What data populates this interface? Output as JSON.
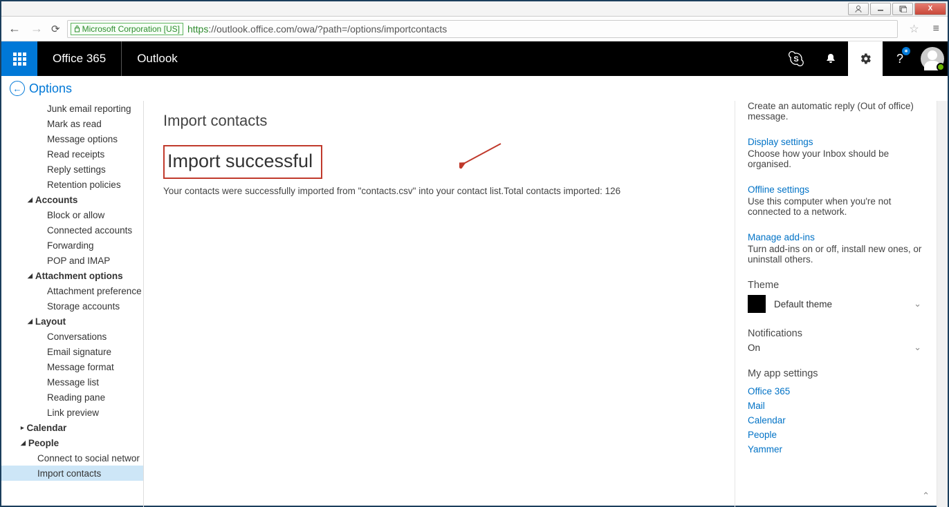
{
  "window": {
    "close_x": "X"
  },
  "browser": {
    "security_badge": "Microsoft Corporation [US]",
    "protocol": "https",
    "url_rest": "://outlook.office.com/owa/?path=/options/importcontacts"
  },
  "suite": {
    "brand1": "Office 365",
    "brand2": "Outlook"
  },
  "optionsbar": {
    "label": "Options"
  },
  "sidebar": {
    "items": [
      "Junk email reporting",
      "Mark as read",
      "Message options",
      "Read receipts",
      "Reply settings",
      "Retention policies"
    ],
    "g_accounts": "Accounts",
    "accounts": [
      "Block or allow",
      "Connected accounts",
      "Forwarding",
      "POP and IMAP"
    ],
    "g_attach": "Attachment options",
    "attach": [
      "Attachment preference",
      "Storage accounts"
    ],
    "g_layout": "Layout",
    "layout": [
      "Conversations",
      "Email signature",
      "Message format",
      "Message list",
      "Reading pane",
      "Link preview"
    ],
    "g_calendar": "Calendar",
    "g_people": "People",
    "people": [
      "Connect to social networ",
      "Import contacts"
    ]
  },
  "main": {
    "heading": "Import contacts",
    "success_heading": "Import successful",
    "success_msg": "Your contacts were successfully imported from \"contacts.csv\" into your contact list.Total contacts imported: 126"
  },
  "right": {
    "auto_desc": "Create an automatic reply (Out of office) message.",
    "display_title": "Display settings",
    "display_desc": "Choose how your Inbox should be organised.",
    "offline_title": "Offline settings",
    "offline_desc": "Use this computer when you're not connected to a network.",
    "addins_title": "Manage add-ins",
    "addins_desc": "Turn add-ins on or off, install new ones, or uninstall others.",
    "theme_heading": "Theme",
    "theme_value": "Default theme",
    "notif_heading": "Notifications",
    "notif_value": "On",
    "apps_heading": "My app settings",
    "apps": [
      "Office 365",
      "Mail",
      "Calendar",
      "People",
      "Yammer"
    ]
  }
}
